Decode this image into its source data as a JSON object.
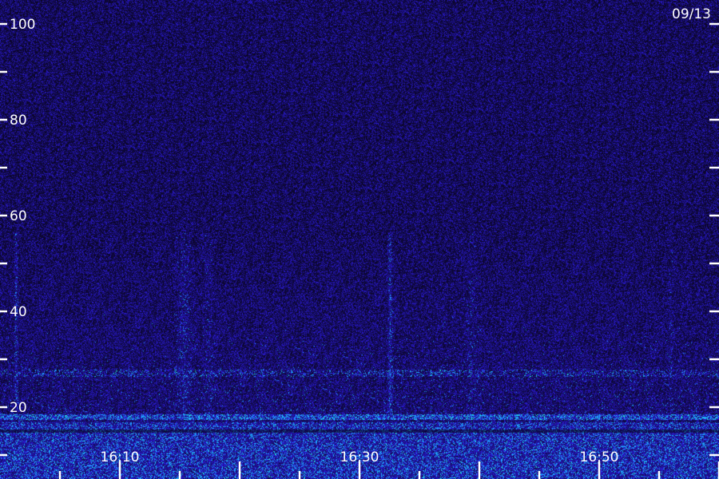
{
  "date_label": "09/13",
  "chart_data": {
    "type": "heatmap",
    "ylim": [
      10,
      102
    ],
    "y_ticks_labeled": [
      20,
      40,
      60,
      80,
      100
    ],
    "y_tick_labels": [
      "20",
      "40",
      "60",
      "80",
      "100"
    ],
    "y_ticks_minor": [
      10,
      30,
      50,
      70,
      90
    ],
    "x_time_start": "16:05",
    "x_time_end": "17:05",
    "x_tick_labels": [
      "16:10",
      "16:30",
      "16:50"
    ],
    "x_tick_label_minutes": [
      10,
      30,
      50
    ],
    "x_ticks_every_minutes": 5,
    "colors": {
      "background": "#0a0630",
      "noise_low": "#1a0a8a",
      "noise_high": "#3a2cff",
      "signal": "#2a8cff",
      "strong": "#30ffd0",
      "axis": "#ffffff"
    }
  }
}
